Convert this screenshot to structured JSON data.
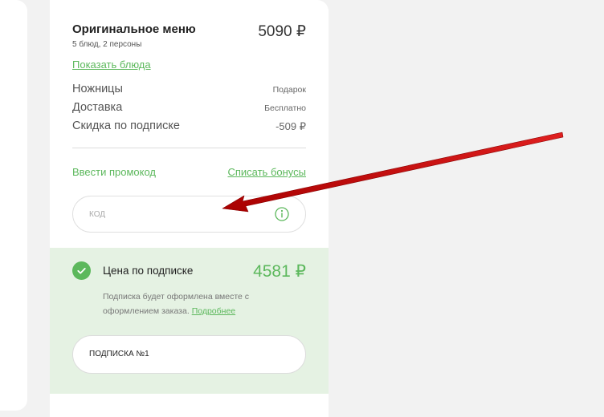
{
  "order": {
    "title": "Оригинальное меню",
    "price": "5090 ₽",
    "subtitle": "5 блюд, 2 персоны",
    "show_dishes_link": "Показать блюда"
  },
  "summary_rows": [
    {
      "label": "Ножницы",
      "value": "Подарок"
    },
    {
      "label": "Доставка",
      "value": "Бесплатно"
    },
    {
      "label": "Скидка по подписке",
      "value": "-509 ₽"
    }
  ],
  "promo": {
    "enter_promo_link": "Ввести промокод",
    "bonus_link": "Списать бонусы",
    "code_placeholder": "КОД",
    "code_value": ""
  },
  "subscription": {
    "label": "Цена по подписке",
    "price": "4581 ₽",
    "note": "Подписка будет оформлена вместе с оформлением заказа.",
    "more_link": "Подробнее",
    "selected_plan": "ПОДПИСКА №1",
    "checked": true
  },
  "colors": {
    "accent_green": "#5cb85c",
    "panel_green": "#e5f2e3",
    "arrow_red": "#c40000"
  },
  "icons": {
    "info": "info-icon",
    "check": "check-circle-icon",
    "arrow": "annotation-arrow"
  }
}
